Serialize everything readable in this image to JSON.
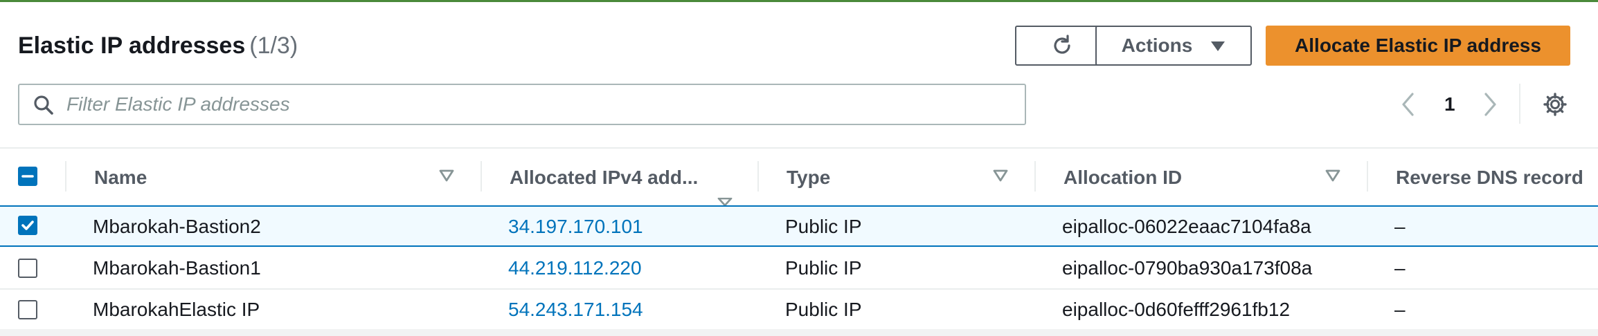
{
  "header": {
    "title": "Elastic IP addresses",
    "count": "(1/3)"
  },
  "toolbar": {
    "refresh_icon": "refresh-icon",
    "actions_label": "Actions",
    "allocate_label": "Allocate Elastic IP address"
  },
  "search": {
    "placeholder": "Filter Elastic IP addresses",
    "value": ""
  },
  "pagination": {
    "current_page": "1"
  },
  "table": {
    "columns": [
      "Name",
      "Allocated IPv4 add...",
      "Type",
      "Allocation ID",
      "Reverse DNS record"
    ],
    "rows": [
      {
        "selected": true,
        "name": "Mbarokah-Bastion2",
        "ip": "34.197.170.101",
        "type": "Public IP",
        "allocation_id": "eipalloc-06022eaac7104fa8a",
        "reverse_dns": "–"
      },
      {
        "selected": false,
        "name": "Mbarokah-Bastion1",
        "ip": "44.219.112.220",
        "type": "Public IP",
        "allocation_id": "eipalloc-0790ba930a173f08a",
        "reverse_dns": "–"
      },
      {
        "selected": false,
        "name": "MbarokahElastic IP",
        "ip": "54.243.171.154",
        "type": "Public IP",
        "allocation_id": "eipalloc-0d60fefff2961fb12",
        "reverse_dns": "–"
      }
    ]
  },
  "colors": {
    "primary": "#ec912d",
    "link": "#0073bb",
    "text": "#16191f",
    "muted": "#545b64"
  }
}
